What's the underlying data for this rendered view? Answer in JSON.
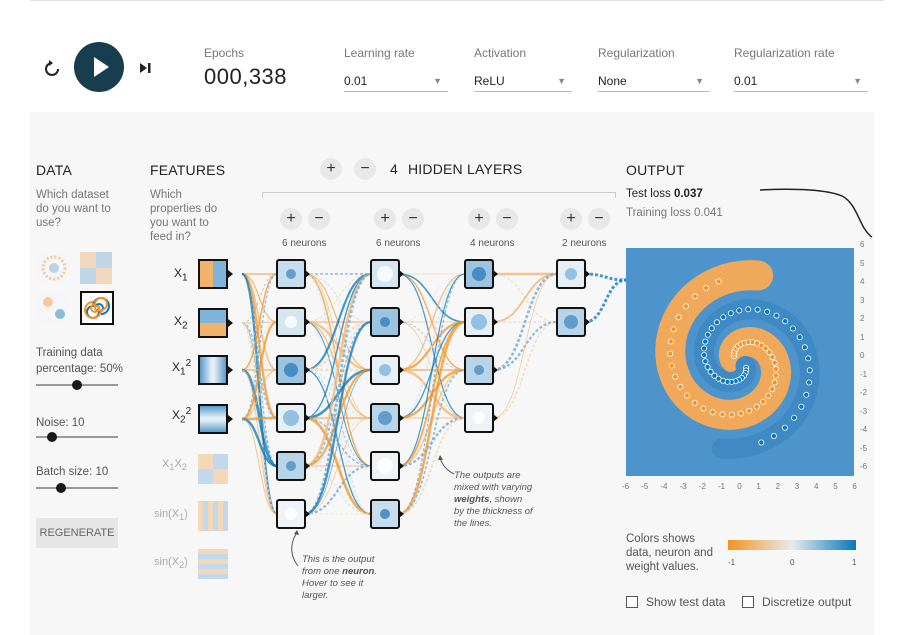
{
  "controls": {
    "reset_icon": "reset-icon",
    "play_icon": "play-icon",
    "step_icon": "step-icon",
    "epochs_label": "Epochs",
    "epochs_value": "000,338",
    "learning_rate_label": "Learning rate",
    "learning_rate_value": "0.01",
    "activation_label": "Activation",
    "activation_value": "ReLU",
    "regularization_label": "Regularization",
    "regularization_value": "None",
    "regularization_rate_label": "Regularization rate",
    "regularization_rate_value": "0.01"
  },
  "data_panel": {
    "heading": "DATA",
    "question_1": "Which dataset",
    "question_2": "do you want to",
    "question_3": "use?",
    "training_label_1": "Training data",
    "training_label_2": "percentage:  50%",
    "training_percent": 50,
    "noise_label": "Noise:  10",
    "noise_value": 10,
    "batch_label": "Batch size:  10",
    "batch_value": 10,
    "regenerate_label": "REGENERATE"
  },
  "features_panel": {
    "heading": "FEATURES",
    "q1": "Which",
    "q2": "properties do",
    "q3": "you want to",
    "q4": "feed in?",
    "features": [
      "X1",
      "X2",
      "X1^2",
      "X2^2",
      "X1X2",
      "sin(X1)",
      "sin(X2)"
    ]
  },
  "network": {
    "hidden_layers_count": "4",
    "hidden_layers_label": "HIDDEN LAYERS",
    "layer_neurons": [
      "6 neurons",
      "6 neurons",
      "4 neurons",
      "2 neurons"
    ],
    "note_neuron_1": "This is the output",
    "note_neuron_2": "from one",
    "note_neuron_bold": "neuron",
    "note_neuron_3": "Hover to see it",
    "note_neuron_4": "larger.",
    "note_weights_1": "The outputs are",
    "note_weights_2": "mixed with varying",
    "note_weights_bold": "weights",
    "note_weights_3": ", shown",
    "note_weights_4": "by the thickness of",
    "note_weights_5": "the lines."
  },
  "output": {
    "heading": "OUTPUT",
    "test_loss_label": "Test loss",
    "test_loss_value": "0.037",
    "training_loss_label": "Training loss",
    "training_loss_value": "0.041",
    "x_ticks": [
      "-6",
      "-5",
      "-4",
      "-3",
      "-2",
      "-1",
      "0",
      "1",
      "2",
      "3",
      "4",
      "5",
      "6"
    ],
    "y_ticks": [
      "6",
      "5",
      "4",
      "3",
      "2",
      "1",
      "0",
      "-1",
      "-2",
      "-3",
      "-4",
      "-5",
      "-6"
    ],
    "legend_1": "Colors shows",
    "legend_2": "data, neuron and",
    "legend_3": "weight values.",
    "legend_min": "-1",
    "legend_mid": "0",
    "legend_max": "1",
    "show_test_label": "Show test data",
    "discretize_label": "Discretize output"
  },
  "colors": {
    "orange": "#f59322",
    "blue": "#0877bd",
    "dark": "#183d4e"
  }
}
